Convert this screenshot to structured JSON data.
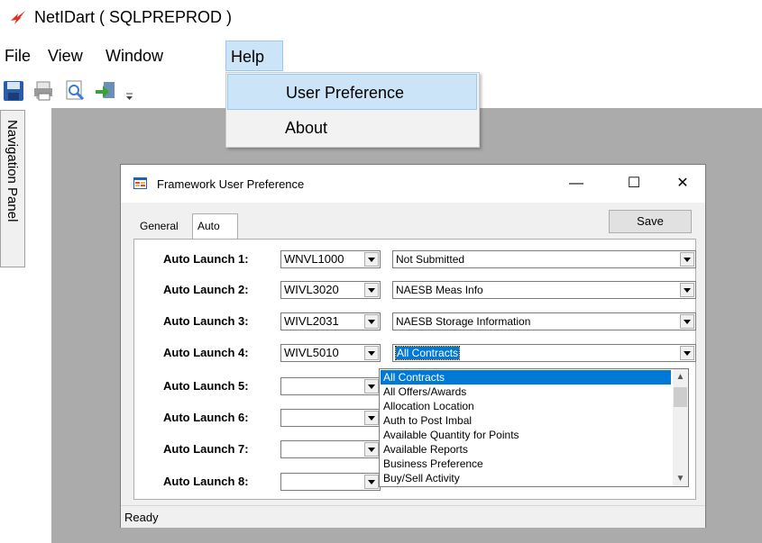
{
  "app": {
    "title": "NetIDart ( SQLPREPROD )"
  },
  "menu": {
    "items": [
      "File",
      "View",
      "Window",
      "Help"
    ],
    "active": "Help"
  },
  "help_menu": {
    "items": [
      "User Preference",
      "About"
    ]
  },
  "toolbar": {
    "icons": [
      "save-icon",
      "print-icon",
      "print-preview-icon",
      "import-icon",
      "overflow-icon"
    ]
  },
  "nav_panel": {
    "label": "Navigation Panel"
  },
  "dialog": {
    "title": "Framework User Preference",
    "minimize": "—",
    "maximize": "☐",
    "close": "✕",
    "tabs": [
      "General",
      "Auto Launch"
    ],
    "selected_tab": "Auto Launch",
    "save_label": "Save",
    "rows": [
      {
        "label": "Auto Launch 1:",
        "code": "WNVL1000",
        "screen": "Not Submitted"
      },
      {
        "label": "Auto Launch 2:",
        "code": "WIVL3020",
        "screen": "NAESB Meas Info"
      },
      {
        "label": "Auto Launch 3:",
        "code": "WIVL2031",
        "screen": "NAESB Storage Information"
      },
      {
        "label": "Auto Launch 4:",
        "code": "WIVL5010",
        "screen": "All Contracts"
      },
      {
        "label": "Auto Launch 5:",
        "code": "",
        "screen": ""
      },
      {
        "label": "Auto Launch 6:",
        "code": "",
        "screen": ""
      },
      {
        "label": "Auto Launch 7:",
        "code": "",
        "screen": ""
      },
      {
        "label": "Auto Launch 8:",
        "code": "",
        "screen": ""
      }
    ],
    "open_list": {
      "items": [
        "All Contracts",
        "All Offers/Awards",
        "Allocation Location",
        "Auth to Post Imbal",
        "Available Quantity for Points",
        "Available Reports",
        "Business Preference",
        "Buy/Sell Activity"
      ],
      "selected": "All Contracts"
    },
    "status": "Ready"
  }
}
